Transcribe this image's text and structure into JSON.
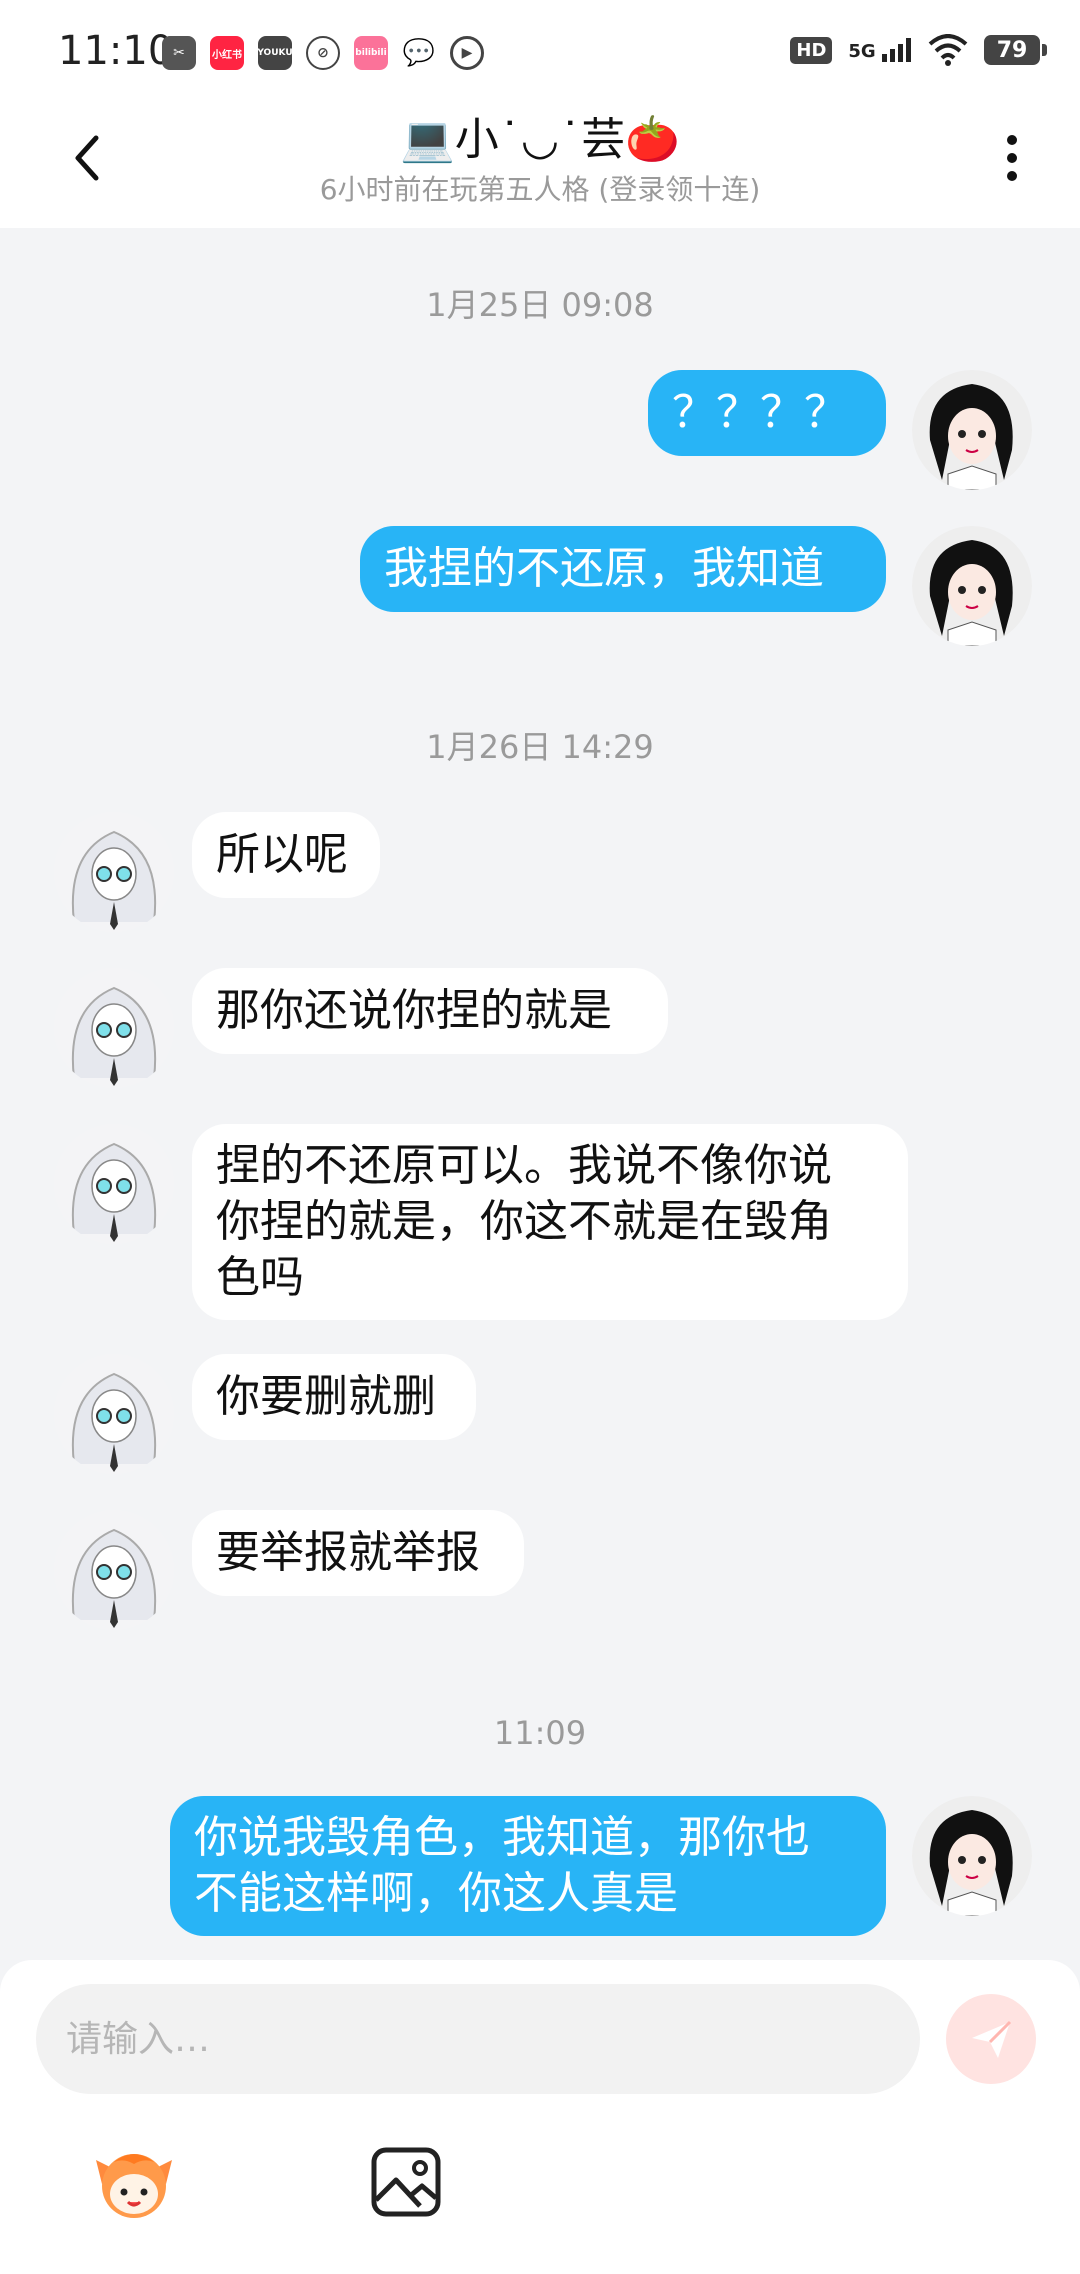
{
  "status_bar": {
    "time": "11:10",
    "app_icons": [
      "app-icon-1",
      "小红书",
      "YOUKU",
      "app-icon-4",
      "bilibili",
      "wechat",
      "play"
    ],
    "network": "5G",
    "hd_label": "HD",
    "battery": "79"
  },
  "header": {
    "title": "💻小˙◡˙芸🍅",
    "subtitle": "6小时前在玩第五人格 (登录领十连)"
  },
  "messages": [
    {
      "type": "timestamp",
      "text": "1月25日 09:08"
    },
    {
      "type": "me",
      "text": "？？？？"
    },
    {
      "type": "me",
      "text": "我捏的不还原，我知道"
    },
    {
      "type": "timestamp",
      "text": "1月26日 14:29"
    },
    {
      "type": "them",
      "text": "所以呢"
    },
    {
      "type": "them",
      "text": "那你还说你捏的就是"
    },
    {
      "type": "them",
      "text": "捏的不还原可以。我说不像你说\n你捏的就是，你这不就是在毁角\n色吗"
    },
    {
      "type": "them",
      "text": "你要删就删"
    },
    {
      "type": "them",
      "text": "要举报就举报"
    },
    {
      "type": "timestamp",
      "text": "11:09"
    },
    {
      "type": "me",
      "text": "你说我毁角色，我知道，那你也\n不能这样啊，你这人真是"
    }
  ],
  "composer": {
    "placeholder": "请输入…",
    "send_icon": "send-icon",
    "toolbar_icons": [
      "mascot-sticker-icon",
      "image-icon"
    ]
  },
  "colors": {
    "my_bubble": "#28b4f6",
    "their_bubble": "#ffffff",
    "background": "#f3f4f6",
    "send_button": "#ffe3e1"
  }
}
